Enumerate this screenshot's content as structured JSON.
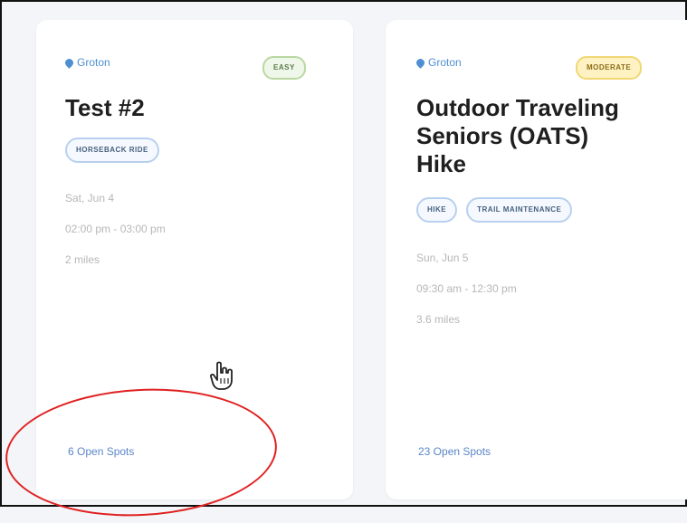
{
  "cards": [
    {
      "location": "Groton",
      "difficulty": "EASY",
      "title": "Test #2",
      "tags": [
        "HORSEBACK RIDE"
      ],
      "date": "Sat, Jun 4",
      "time": "02:00 pm - 03:00 pm",
      "distance": "2 miles",
      "open_spots": "6 Open Spots"
    },
    {
      "location": "Groton",
      "difficulty": "MODERATE",
      "title_lines": [
        "Outdoor Traveling",
        "Seniors (OATS)",
        "Hike"
      ],
      "tags": [
        "HIKE",
        "TRAIL MAINTENANCE"
      ],
      "date": "Sun, Jun 5",
      "time": "09:30 am - 12:30 pm",
      "distance": "3.6 miles",
      "open_spots": "23 Open Spots"
    }
  ],
  "colors": {
    "accent_blue": "#4d8fd1",
    "annotation_red": "#e02020"
  }
}
